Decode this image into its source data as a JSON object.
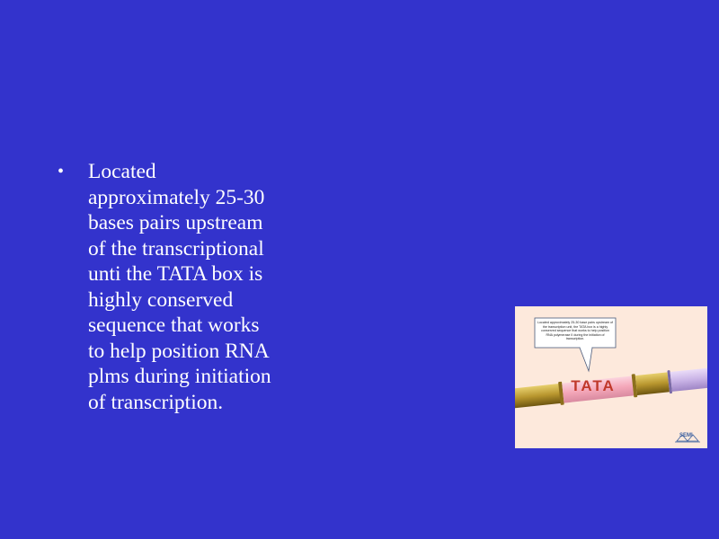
{
  "slide": {
    "background_color": "#3333cc",
    "bullets": [
      {
        "text": "Located\napproximately 25-30\nbases pairs upstream\nof the transcriptional\nunti the TATA box is\nhighly conserved\nsequence that works\nto help position RNA\nplms during initiation\nof transcription."
      }
    ]
  },
  "figure": {
    "callout_text": "Located approximately 25-30 base pairs upstream of the transcription unit, the TATA box is a highly conserved sequence that works to help position RNA polymerase II during the initiation of transcription.",
    "tata_label": "TATA",
    "logo_text": "SEMI",
    "colors": {
      "background": "#fde9dc",
      "dna_gold": "#b8962e",
      "tata_region": "#f4a7b9",
      "dna_lavender": "#c9b3e6",
      "tata_text": "#c0392b"
    }
  }
}
